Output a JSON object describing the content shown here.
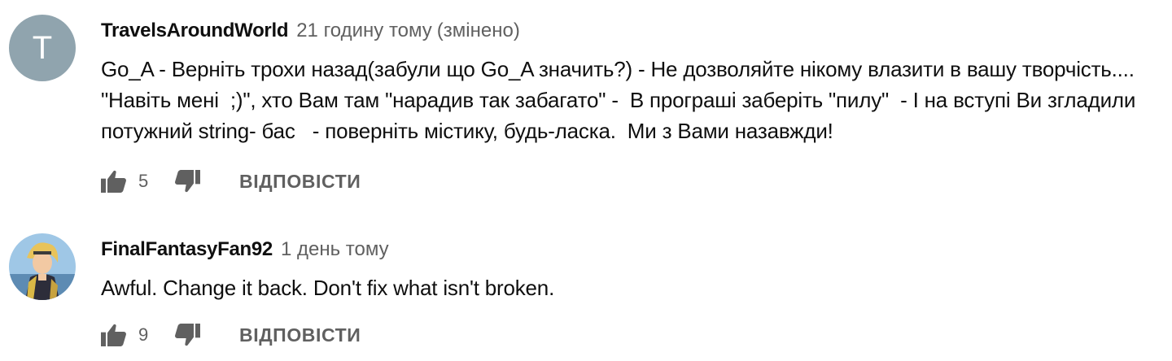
{
  "comments": [
    {
      "author": "TravelsAroundWorld",
      "time": "21 годину тому",
      "edited": "(змінено)",
      "avatar_letter": "T",
      "text": "Go_A - Верніть трохи назад(забули що Go_A значить?) - Не дозволяйте нікому влазити в вашу творчість.... \"Навіть мені  ;)\", хто Вам там \"нарадив так забагато\" -  В програші заберіть \"пилу\"  - І на вступі Ви згладили потужний string- бас   - поверніть містику, будь-ласка.  Ми з Вами назавжди!",
      "likes": "5",
      "reply_label": "ВІДПОВІСТИ"
    },
    {
      "author": "FinalFantasyFan92",
      "time": "1 день тому",
      "text": "Awful. Change it back. Don't fix what isn't broken.",
      "likes": "9",
      "reply_label": "ВІДПОВІСТИ"
    }
  ],
  "icons": {
    "like": "thumbs-up-icon",
    "dislike": "thumbs-down-icon"
  },
  "colors": {
    "primary_text": "#0f0f0f",
    "secondary_text": "#606060",
    "icon": "#606060",
    "avatar_bg": "#90a4ae"
  }
}
